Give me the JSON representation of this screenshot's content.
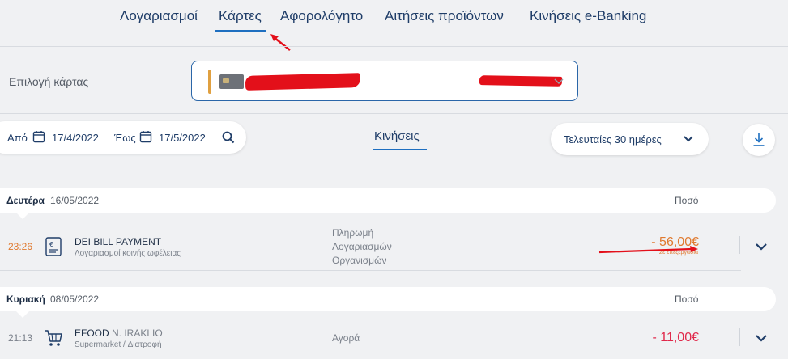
{
  "nav": {
    "items": [
      {
        "label": "Λογαριασμοί"
      },
      {
        "label": "Κάρτες"
      },
      {
        "label": "Αφορολόγητο"
      },
      {
        "label": "Αιτήσεις προϊόντων"
      },
      {
        "label": "Κινήσεις e-Banking"
      }
    ],
    "active": "Κάρτες"
  },
  "card_selector": {
    "label": "Επιλογή κάρτας"
  },
  "filters": {
    "from_label": "Από",
    "from_date": "17/4/2022",
    "to_label": "Έως",
    "to_date": "17/5/2022",
    "tab_label": "Κινήσεις",
    "period_label": "Τελευταίες 30 ημέρες"
  },
  "days": [
    {
      "day": "Δευτέρα",
      "date": "16/05/2022",
      "amount_header": "Ποσό",
      "transactions": [
        {
          "time": "23:26",
          "icon": "bill-icon",
          "title": "DEI BILL PAYMENT",
          "title_sub": "",
          "category": "Λογαριασμοί κοινής ωφέλειας",
          "type": [
            "Πληρωμή",
            "Λογαριασμών",
            "Οργανισμών"
          ],
          "amount": "- 56,00€",
          "status": "Σε επεξεργασία"
        }
      ]
    },
    {
      "day": "Κυριακή",
      "date": "08/05/2022",
      "amount_header": "Ποσό",
      "transactions": [
        {
          "time": "21:13",
          "icon": "cart-icon",
          "title": "EFOOD",
          "title_sub": "N. IRAKLIO",
          "category": "Supermarket / Διατροφή",
          "type": [
            "Αγορά"
          ],
          "amount": "- 11,00€",
          "status": ""
        }
      ]
    }
  ],
  "colors": {
    "accent": "#1e6fc0",
    "text_dark": "#1f3d68",
    "pending": "#e07a30",
    "negative": "#e0284a",
    "annotation_red": "#e3101a"
  }
}
